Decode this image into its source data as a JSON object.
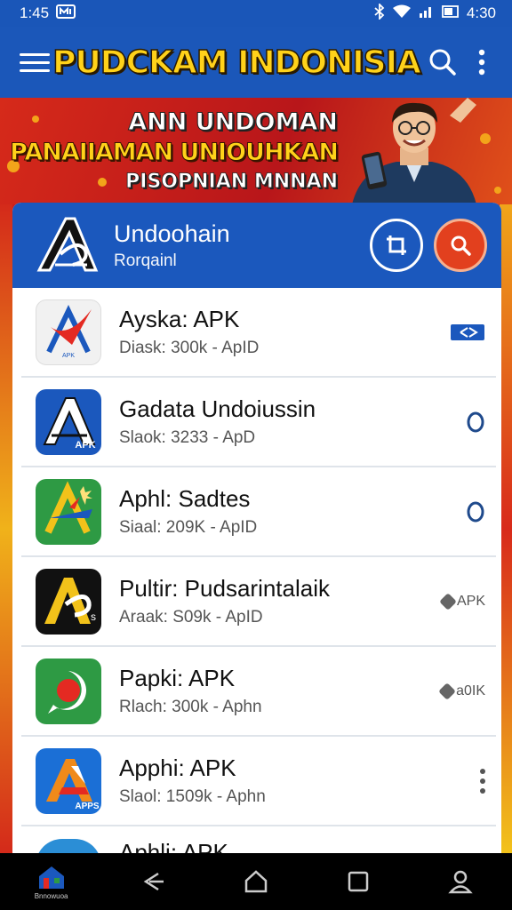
{
  "status_bar": {
    "time_left": "1:45",
    "time_right": "4:30"
  },
  "app_bar": {
    "title": "PUDCKAM INDONISIA"
  },
  "banner": {
    "line1": "ANN UNDOMAN",
    "line2": "PANAIIAMAN UNIOUHKAN",
    "line3": "PISOPNIAN MNNAN"
  },
  "list_header": {
    "title": "Undoohain",
    "subtitle": "Rorqainl"
  },
  "apps": [
    {
      "name": "Ayska: APK",
      "meta": "Diask: 300k - ApID",
      "icon_text": "APK",
      "action": "tag"
    },
    {
      "name": "Gadata Undoiussin",
      "meta": "Slaok: 3233 - ApD",
      "icon_text": "APK",
      "action": "circle"
    },
    {
      "name": "Aphl: Sadtes",
      "meta": "Siaal: 209K - ApID",
      "icon_text": "",
      "action": "circle"
    },
    {
      "name": "Pultir: Pudsarintalaik",
      "meta": "Araak: S09k - ApID",
      "icon_text": "",
      "action": "badge",
      "badge": "APK"
    },
    {
      "name": "Papki: APK",
      "meta": "Rlach: 300k - Aphn",
      "icon_text": "",
      "action": "badge",
      "badge": "a0IK"
    },
    {
      "name": "Apphi: APK",
      "meta": "Slaol: 1509k - Aphn",
      "icon_text": "APPS",
      "action": "more"
    },
    {
      "name": "Aphli: APK",
      "meta": "",
      "icon_text": "",
      "action": "none"
    }
  ],
  "nav": {
    "home_label": "Bnnowuoa"
  },
  "colors": {
    "primary_blue": "#1b57b9",
    "banner_red": "#c8201e",
    "title_yellow": "#ffd21a",
    "accent_orange": "#e2401e"
  }
}
